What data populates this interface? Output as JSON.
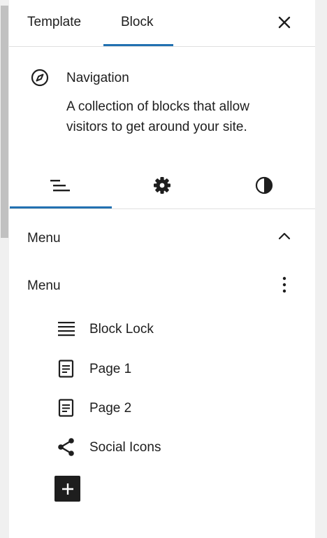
{
  "header": {
    "tabs": [
      {
        "label": "Template"
      },
      {
        "label": "Block"
      }
    ]
  },
  "block": {
    "title": "Navigation",
    "description": "A collection of blocks that allow visitors to get around your site."
  },
  "section": {
    "title": "Menu"
  },
  "menu": {
    "label": "Menu",
    "items": [
      {
        "label": "Block Lock",
        "icon": "list-lines-icon"
      },
      {
        "label": "Page 1",
        "icon": "page-icon"
      },
      {
        "label": "Page 2",
        "icon": "page-icon"
      },
      {
        "label": "Social Icons",
        "icon": "share-icon"
      }
    ]
  },
  "colors": {
    "accent": "#2271b1",
    "text": "#1e1e1e",
    "divider": "#e0e0e0"
  }
}
